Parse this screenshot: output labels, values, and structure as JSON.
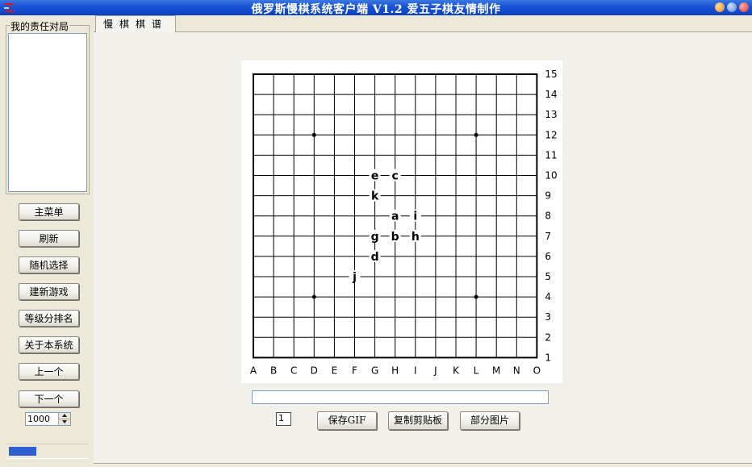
{
  "window": {
    "title": "俄罗斯慢棋系统客户端  V1.2 爱五子棋友情制作",
    "controls": [
      "minimize",
      "maximize",
      "close"
    ],
    "app_icon": "z-logo-icon"
  },
  "sidebar": {
    "group_title": "我的责任对局",
    "buttons": [
      {
        "label": "主菜单"
      },
      {
        "label": "刷新"
      },
      {
        "label": "随机选择"
      },
      {
        "label": "建新游戏"
      },
      {
        "label": "等级分排名"
      },
      {
        "label": "关于本系统"
      },
      {
        "label": "上一个"
      },
      {
        "label": "下一个"
      }
    ],
    "spinner_value": "1000",
    "progress_fraction": 0.35
  },
  "tab": {
    "label": "慢棋棋谱"
  },
  "board": {
    "size": 15,
    "columns": [
      "A",
      "B",
      "C",
      "D",
      "E",
      "F",
      "G",
      "H",
      "I",
      "J",
      "K",
      "L",
      "M",
      "N",
      "O"
    ],
    "rows": [
      "15",
      "14",
      "13",
      "12",
      "11",
      "10",
      "9",
      "8",
      "7",
      "6",
      "5",
      "4",
      "3",
      "2",
      "1"
    ],
    "star_points": [
      [
        "D",
        12
      ],
      [
        "L",
        12
      ],
      [
        "D",
        4
      ],
      [
        "L",
        4
      ]
    ],
    "marks": [
      {
        "label": "e",
        "col": "G",
        "row": 10
      },
      {
        "label": "c",
        "col": "H",
        "row": 10
      },
      {
        "label": "k",
        "col": "G",
        "row": 9
      },
      {
        "label": "a",
        "col": "H",
        "row": 8
      },
      {
        "label": "i",
        "col": "I",
        "row": 8
      },
      {
        "label": "g",
        "col": "G",
        "row": 7
      },
      {
        "label": "b",
        "col": "H",
        "row": 7
      },
      {
        "label": "h",
        "col": "I",
        "row": 7
      },
      {
        "label": "d",
        "col": "G",
        "row": 6
      },
      {
        "label": "j",
        "col": "F",
        "row": 5
      }
    ]
  },
  "footer": {
    "status_text": "",
    "page_value": "1",
    "save_gif_label": "保存GIF",
    "copy_label": "复制剪贴板",
    "partial_image_label": "部分图片"
  }
}
